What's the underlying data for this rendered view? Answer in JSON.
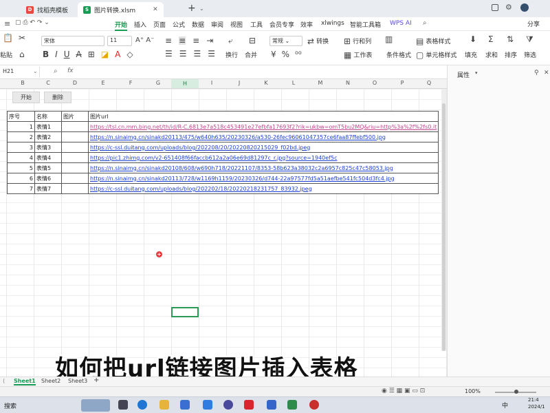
{
  "titlebar": {
    "tabs": [
      {
        "label": "找稻壳模板",
        "icon_color": "#e8483f",
        "icon_text": "D"
      },
      {
        "label": "图片转换.xlsm",
        "icon_color": "#1a9b55",
        "icon_text": "S"
      }
    ],
    "new_tab": "+",
    "right_icons": [
      "window-icon",
      "gear-icon",
      "avatar"
    ]
  },
  "menubar": {
    "items": [
      "开始",
      "插入",
      "页面",
      "公式",
      "数据",
      "审阅",
      "视图",
      "工具",
      "会员专享",
      "效率",
      "xlwings",
      "智能工具箱",
      "WPS AI"
    ],
    "active": "开始",
    "share": "分享"
  },
  "toolbar": {
    "paste": "粘贴",
    "format_painter": "格式刷",
    "font_name": "宋体",
    "font_size": "11",
    "wrap": "换行",
    "merge": "合并",
    "convert": "转换",
    "rows_cols": "行和列",
    "worksheet": "工作表",
    "cond_format": "条件格式",
    "table_style": "表格样式",
    "cell_style": "单元格样式",
    "fill": "填充",
    "sum": "求和",
    "sort": "排序",
    "filter": "筛选"
  },
  "formulabar": {
    "namebox": "H21",
    "fx": "fx"
  },
  "panel": {
    "title": "属性"
  },
  "columns": [
    "B",
    "C",
    "D",
    "E",
    "F",
    "G",
    "H",
    "I",
    "J",
    "K",
    "L",
    "M",
    "N",
    "O",
    "P",
    "Q"
  ],
  "selected_col": "H",
  "buttons": {
    "start": "开始",
    "delete": "删除"
  },
  "table": {
    "headers": [
      "序号",
      "名称",
      "图片",
      "图片url"
    ],
    "rows": [
      {
        "no": "1",
        "name": "表情1",
        "url": "https://tsl.cn.mm.bing.net/th/id/R-C.6813e7a518c453491e27efbfa17693f2?rik=ukbw=omT5bu2MQ&riu=http%3a%2f%2fs0.it"
      },
      {
        "no": "2",
        "name": "表情2",
        "url": "https://n.sinaimg.cn/sinakd20113/475/w640h635/20230326/a530-26fec96061047357ce6faa87ffebf500.jpg"
      },
      {
        "no": "3",
        "name": "表情3",
        "url": "https://c-ssl.duitang.com/uploads/blog/202208/20/20220820215029_f02bd.jpeg"
      },
      {
        "no": "4",
        "name": "表情4",
        "url": "https://pic1.zhimg.com/v2-651408f66faccb612a2a06e69d81297c_r.jpg?source=1940ef5c"
      },
      {
        "no": "5",
        "name": "表情5",
        "url": "https://n.sinaimg.cn/sinakd20108/608/w690h718/20221107/8353-58b623a38032c2a6957c825c47c58053.jpg"
      },
      {
        "no": "6",
        "name": "表情6",
        "url": "https://n.sinaimg.cn/sinakd20113/728/w1169h1159/20230326/d744-22a97577fd5a51aefbe541fc504d3fc4.jpg"
      },
      {
        "no": "7",
        "name": "表情7",
        "url": "https://c-ssl.duitang.com/uploads/blog/202202/18/20220218231757_83932.jpeg"
      }
    ]
  },
  "caption": "如何把url链接图片插入表格",
  "sheets": [
    "Sheet1",
    "Sheet2",
    "Sheet3"
  ],
  "active_sheet": "Sheet1",
  "status": {
    "zoom": "100%"
  },
  "taskbar": {
    "search": "搜索",
    "time": "21:4",
    "date": "2024/1",
    "ime": "中"
  }
}
